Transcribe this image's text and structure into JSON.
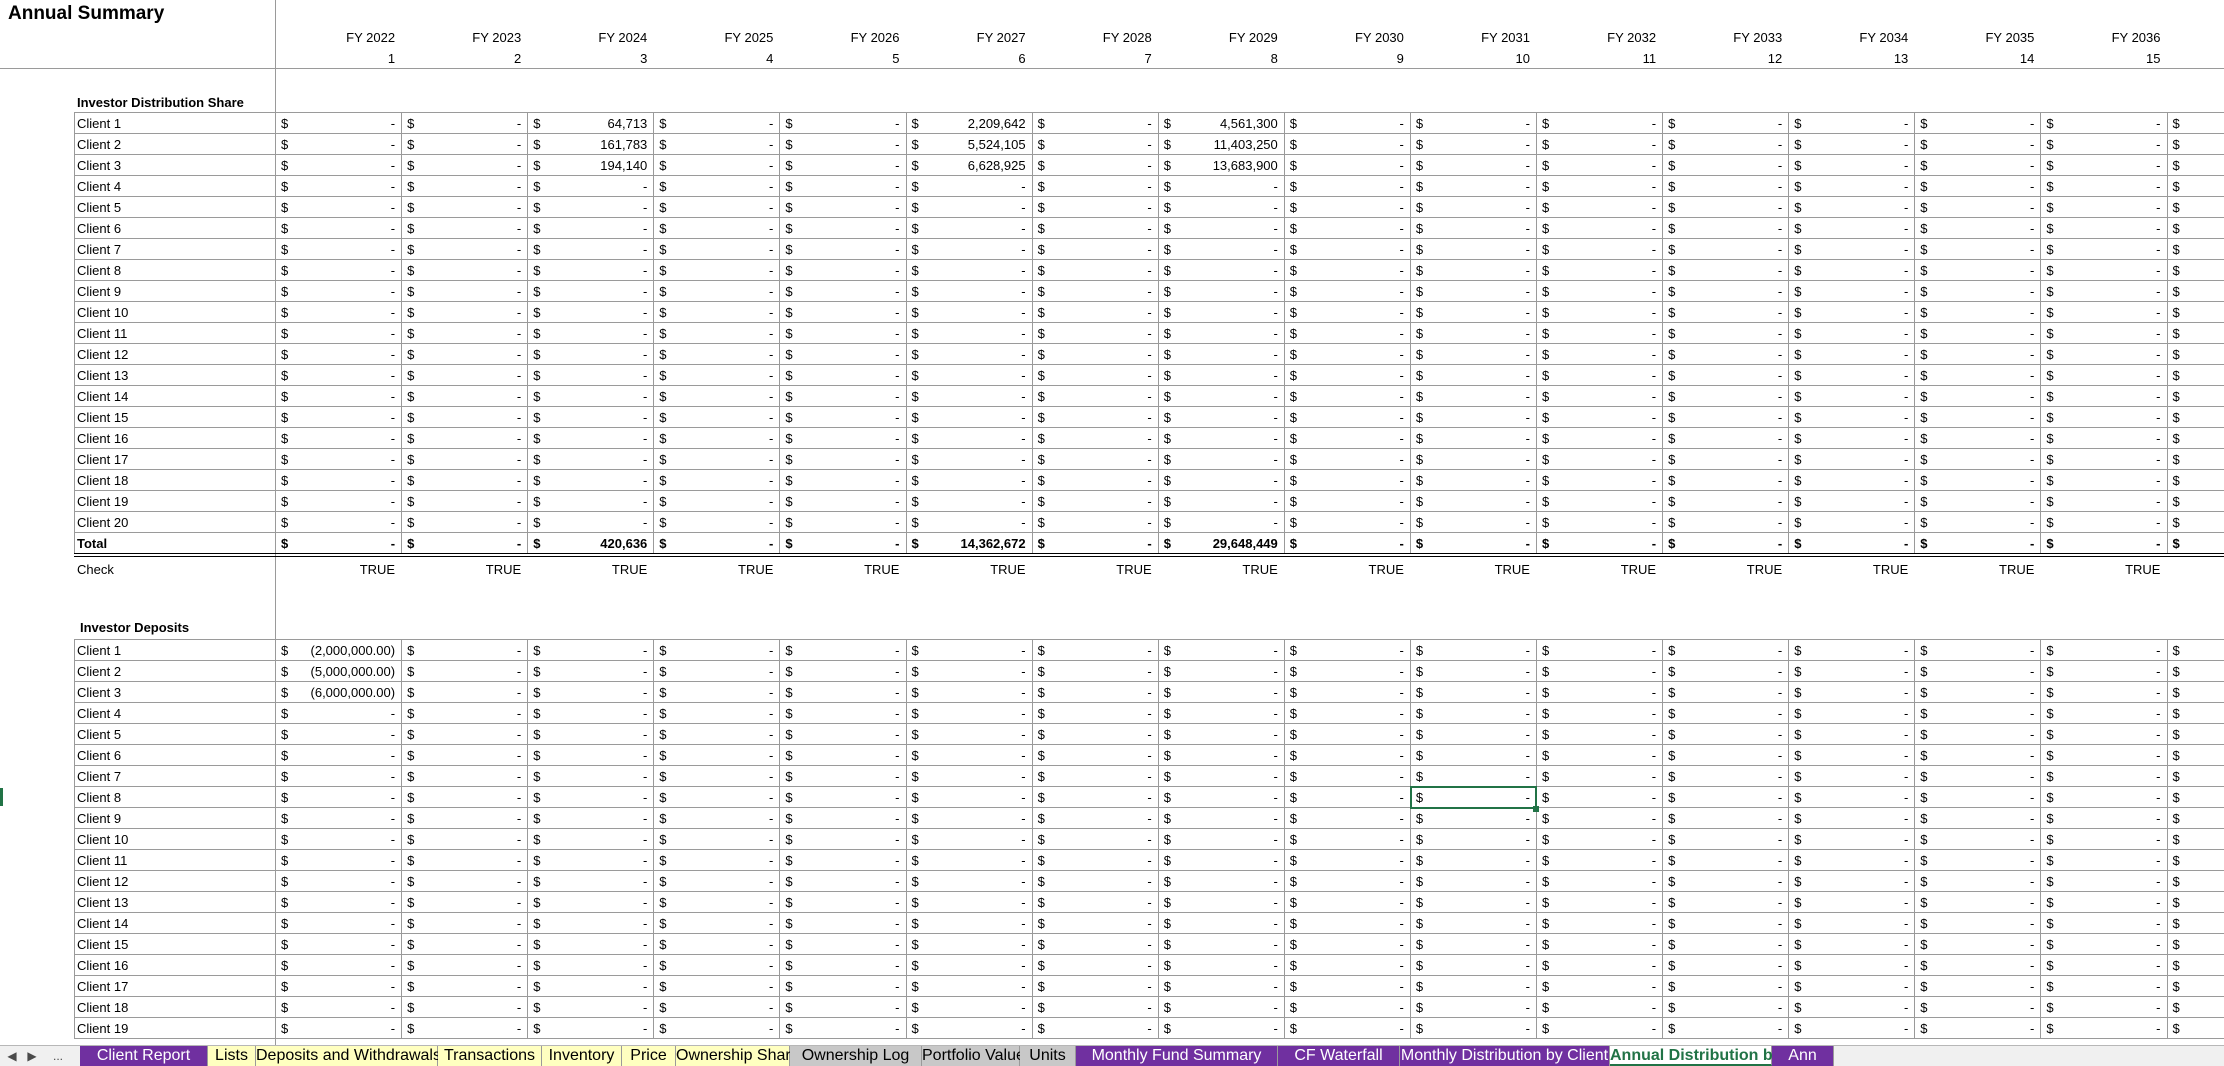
{
  "title": "Annual Summary",
  "columns": [
    {
      "fy": "FY 2022",
      "num": "1"
    },
    {
      "fy": "FY 2023",
      "num": "2"
    },
    {
      "fy": "FY 2024",
      "num": "3"
    },
    {
      "fy": "FY 2025",
      "num": "4"
    },
    {
      "fy": "FY 2026",
      "num": "5"
    },
    {
      "fy": "FY 2027",
      "num": "6"
    },
    {
      "fy": "FY 2028",
      "num": "7"
    },
    {
      "fy": "FY 2029",
      "num": "8"
    },
    {
      "fy": "FY 2030",
      "num": "9"
    },
    {
      "fy": "FY 2031",
      "num": "10"
    },
    {
      "fy": "FY 2032",
      "num": "11"
    },
    {
      "fy": "FY 2033",
      "num": "12"
    },
    {
      "fy": "FY 2034",
      "num": "13"
    },
    {
      "fy": "FY 2035",
      "num": "14"
    },
    {
      "fy": "FY 2036",
      "num": "15"
    },
    {
      "fy": "",
      "num": ""
    }
  ],
  "currency_symbol": "$",
  "distribution": {
    "title": "Investor Distribution Share",
    "rows": [
      {
        "label": "Client 1",
        "values": [
          "-",
          "-",
          "64,713",
          "-",
          "-",
          "2,209,642",
          "-",
          "4,561,300",
          "-",
          "-",
          "-",
          "-",
          "-",
          "-",
          "-",
          ""
        ]
      },
      {
        "label": "Client 2",
        "values": [
          "-",
          "-",
          "161,783",
          "-",
          "-",
          "5,524,105",
          "-",
          "11,403,250",
          "-",
          "-",
          "-",
          "-",
          "-",
          "-",
          "-",
          ""
        ]
      },
      {
        "label": "Client 3",
        "values": [
          "-",
          "-",
          "194,140",
          "-",
          "-",
          "6,628,925",
          "-",
          "13,683,900",
          "-",
          "-",
          "-",
          "-",
          "-",
          "-",
          "-",
          ""
        ]
      },
      {
        "label": "Client 4",
        "values": [
          "-",
          "-",
          "-",
          "-",
          "-",
          "-",
          "-",
          "-",
          "-",
          "-",
          "-",
          "-",
          "-",
          "-",
          "-",
          ""
        ]
      },
      {
        "label": "Client 5",
        "values": [
          "-",
          "-",
          "-",
          "-",
          "-",
          "-",
          "-",
          "-",
          "-",
          "-",
          "-",
          "-",
          "-",
          "-",
          "-",
          ""
        ]
      },
      {
        "label": "Client 6",
        "values": [
          "-",
          "-",
          "-",
          "-",
          "-",
          "-",
          "-",
          "-",
          "-",
          "-",
          "-",
          "-",
          "-",
          "-",
          "-",
          ""
        ]
      },
      {
        "label": "Client 7",
        "values": [
          "-",
          "-",
          "-",
          "-",
          "-",
          "-",
          "-",
          "-",
          "-",
          "-",
          "-",
          "-",
          "-",
          "-",
          "-",
          ""
        ]
      },
      {
        "label": "Client 8",
        "values": [
          "-",
          "-",
          "-",
          "-",
          "-",
          "-",
          "-",
          "-",
          "-",
          "-",
          "-",
          "-",
          "-",
          "-",
          "-",
          ""
        ]
      },
      {
        "label": "Client 9",
        "values": [
          "-",
          "-",
          "-",
          "-",
          "-",
          "-",
          "-",
          "-",
          "-",
          "-",
          "-",
          "-",
          "-",
          "-",
          "-",
          ""
        ]
      },
      {
        "label": "Client 10",
        "values": [
          "-",
          "-",
          "-",
          "-",
          "-",
          "-",
          "-",
          "-",
          "-",
          "-",
          "-",
          "-",
          "-",
          "-",
          "-",
          ""
        ]
      },
      {
        "label": "Client 11",
        "values": [
          "-",
          "-",
          "-",
          "-",
          "-",
          "-",
          "-",
          "-",
          "-",
          "-",
          "-",
          "-",
          "-",
          "-",
          "-",
          ""
        ]
      },
      {
        "label": "Client 12",
        "values": [
          "-",
          "-",
          "-",
          "-",
          "-",
          "-",
          "-",
          "-",
          "-",
          "-",
          "-",
          "-",
          "-",
          "-",
          "-",
          ""
        ]
      },
      {
        "label": "Client 13",
        "values": [
          "-",
          "-",
          "-",
          "-",
          "-",
          "-",
          "-",
          "-",
          "-",
          "-",
          "-",
          "-",
          "-",
          "-",
          "-",
          ""
        ]
      },
      {
        "label": "Client 14",
        "values": [
          "-",
          "-",
          "-",
          "-",
          "-",
          "-",
          "-",
          "-",
          "-",
          "-",
          "-",
          "-",
          "-",
          "-",
          "-",
          ""
        ]
      },
      {
        "label": "Client 15",
        "values": [
          "-",
          "-",
          "-",
          "-",
          "-",
          "-",
          "-",
          "-",
          "-",
          "-",
          "-",
          "-",
          "-",
          "-",
          "-",
          ""
        ]
      },
      {
        "label": "Client 16",
        "values": [
          "-",
          "-",
          "-",
          "-",
          "-",
          "-",
          "-",
          "-",
          "-",
          "-",
          "-",
          "-",
          "-",
          "-",
          "-",
          ""
        ]
      },
      {
        "label": "Client 17",
        "values": [
          "-",
          "-",
          "-",
          "-",
          "-",
          "-",
          "-",
          "-",
          "-",
          "-",
          "-",
          "-",
          "-",
          "-",
          "-",
          ""
        ]
      },
      {
        "label": "Client 18",
        "values": [
          "-",
          "-",
          "-",
          "-",
          "-",
          "-",
          "-",
          "-",
          "-",
          "-",
          "-",
          "-",
          "-",
          "-",
          "-",
          ""
        ]
      },
      {
        "label": "Client 19",
        "values": [
          "-",
          "-",
          "-",
          "-",
          "-",
          "-",
          "-",
          "-",
          "-",
          "-",
          "-",
          "-",
          "-",
          "-",
          "-",
          ""
        ]
      },
      {
        "label": "Client 20",
        "values": [
          "-",
          "-",
          "-",
          "-",
          "-",
          "-",
          "-",
          "-",
          "-",
          "-",
          "-",
          "-",
          "-",
          "-",
          "-",
          ""
        ]
      }
    ],
    "total": {
      "label": "Total",
      "values": [
        "-",
        "-",
        "420,636",
        "-",
        "-",
        "14,362,672",
        "-",
        "29,648,449",
        "-",
        "-",
        "-",
        "-",
        "-",
        "-",
        "-",
        ""
      ]
    },
    "check": {
      "label": "Check",
      "values": [
        "TRUE",
        "TRUE",
        "TRUE",
        "TRUE",
        "TRUE",
        "TRUE",
        "TRUE",
        "TRUE",
        "TRUE",
        "TRUE",
        "TRUE",
        "TRUE",
        "TRUE",
        "TRUE",
        "TRUE",
        ""
      ]
    }
  },
  "deposits": {
    "title": "Investor Deposits",
    "rows": [
      {
        "label": "Client 1",
        "values": [
          "(2,000,000.00)",
          "-",
          "-",
          "-",
          "-",
          "-",
          "-",
          "-",
          "-",
          "-",
          "-",
          "-",
          "-",
          "-",
          "-",
          ""
        ]
      },
      {
        "label": "Client 2",
        "values": [
          "(5,000,000.00)",
          "-",
          "-",
          "-",
          "-",
          "-",
          "-",
          "-",
          "-",
          "-",
          "-",
          "-",
          "-",
          "-",
          "-",
          ""
        ]
      },
      {
        "label": "Client 3",
        "values": [
          "(6,000,000.00)",
          "-",
          "-",
          "-",
          "-",
          "-",
          "-",
          "-",
          "-",
          "-",
          "-",
          "-",
          "-",
          "-",
          "-",
          ""
        ]
      },
      {
        "label": "Client 4",
        "values": [
          "-",
          "-",
          "-",
          "-",
          "-",
          "-",
          "-",
          "-",
          "-",
          "-",
          "-",
          "-",
          "-",
          "-",
          "-",
          ""
        ]
      },
      {
        "label": "Client 5",
        "values": [
          "-",
          "-",
          "-",
          "-",
          "-",
          "-",
          "-",
          "-",
          "-",
          "-",
          "-",
          "-",
          "-",
          "-",
          "-",
          ""
        ]
      },
      {
        "label": "Client 6",
        "values": [
          "-",
          "-",
          "-",
          "-",
          "-",
          "-",
          "-",
          "-",
          "-",
          "-",
          "-",
          "-",
          "-",
          "-",
          "-",
          ""
        ]
      },
      {
        "label": "Client 7",
        "values": [
          "-",
          "-",
          "-",
          "-",
          "-",
          "-",
          "-",
          "-",
          "-",
          "-",
          "-",
          "-",
          "-",
          "-",
          "-",
          ""
        ]
      },
      {
        "label": "Client 8",
        "values": [
          "-",
          "-",
          "-",
          "-",
          "-",
          "-",
          "-",
          "-",
          "-",
          "-",
          "-",
          "-",
          "-",
          "-",
          "-",
          ""
        ]
      },
      {
        "label": "Client 9",
        "values": [
          "-",
          "-",
          "-",
          "-",
          "-",
          "-",
          "-",
          "-",
          "-",
          "-",
          "-",
          "-",
          "-",
          "-",
          "-",
          ""
        ]
      },
      {
        "label": "Client 10",
        "values": [
          "-",
          "-",
          "-",
          "-",
          "-",
          "-",
          "-",
          "-",
          "-",
          "-",
          "-",
          "-",
          "-",
          "-",
          "-",
          ""
        ]
      },
      {
        "label": "Client 11",
        "values": [
          "-",
          "-",
          "-",
          "-",
          "-",
          "-",
          "-",
          "-",
          "-",
          "-",
          "-",
          "-",
          "-",
          "-",
          "-",
          ""
        ]
      },
      {
        "label": "Client 12",
        "values": [
          "-",
          "-",
          "-",
          "-",
          "-",
          "-",
          "-",
          "-",
          "-",
          "-",
          "-",
          "-",
          "-",
          "-",
          "-",
          ""
        ]
      },
      {
        "label": "Client 13",
        "values": [
          "-",
          "-",
          "-",
          "-",
          "-",
          "-",
          "-",
          "-",
          "-",
          "-",
          "-",
          "-",
          "-",
          "-",
          "-",
          ""
        ]
      },
      {
        "label": "Client 14",
        "values": [
          "-",
          "-",
          "-",
          "-",
          "-",
          "-",
          "-",
          "-",
          "-",
          "-",
          "-",
          "-",
          "-",
          "-",
          "-",
          ""
        ]
      },
      {
        "label": "Client 15",
        "values": [
          "-",
          "-",
          "-",
          "-",
          "-",
          "-",
          "-",
          "-",
          "-",
          "-",
          "-",
          "-",
          "-",
          "-",
          "-",
          ""
        ]
      },
      {
        "label": "Client 16",
        "values": [
          "-",
          "-",
          "-",
          "-",
          "-",
          "-",
          "-",
          "-",
          "-",
          "-",
          "-",
          "-",
          "-",
          "-",
          "-",
          ""
        ]
      },
      {
        "label": "Client 17",
        "values": [
          "-",
          "-",
          "-",
          "-",
          "-",
          "-",
          "-",
          "-",
          "-",
          "-",
          "-",
          "-",
          "-",
          "-",
          "-",
          ""
        ]
      },
      {
        "label": "Client 18",
        "values": [
          "-",
          "-",
          "-",
          "-",
          "-",
          "-",
          "-",
          "-",
          "-",
          "-",
          "-",
          "-",
          "-",
          "-",
          "-",
          ""
        ]
      },
      {
        "label": "Client 19",
        "values": [
          "-",
          "-",
          "-",
          "-",
          "-",
          "-",
          "-",
          "-",
          "-",
          "-",
          "-",
          "-",
          "-",
          "-",
          "-",
          ""
        ]
      }
    ]
  },
  "selected_cell": {
    "section": "deposits",
    "row": 7,
    "col": 9
  },
  "tabbar": {
    "nav": [
      "◀",
      "▶",
      "..."
    ],
    "tabs": [
      {
        "label": "Client Report",
        "style": "purple"
      },
      {
        "label": "Lists",
        "style": "yellow"
      },
      {
        "label": "Deposits and Withdrawals",
        "style": "yellow"
      },
      {
        "label": "Transactions",
        "style": "yellow"
      },
      {
        "label": "Inventory",
        "style": "yellow"
      },
      {
        "label": "Price",
        "style": "yellow"
      },
      {
        "label": "Ownership Share",
        "style": "yellow"
      },
      {
        "label": "Ownership Log",
        "style": "gray"
      },
      {
        "label": "Portfolio Value",
        "style": "gray"
      },
      {
        "label": "Units",
        "style": "gray"
      },
      {
        "label": "Monthly Fund Summary",
        "style": "purple"
      },
      {
        "label": "CF Waterfall",
        "style": "purple"
      },
      {
        "label": "Monthly Distribution by Client",
        "style": "purple"
      },
      {
        "label": "Annual Distribution by Client",
        "style": "active"
      },
      {
        "label": "Ann",
        "style": "purple"
      }
    ]
  },
  "colors": {
    "accent": "#217346",
    "purple_tab": "#7030a0",
    "yellow_tab": "#ffffc0",
    "gray_tab": "#c8c8c8"
  }
}
